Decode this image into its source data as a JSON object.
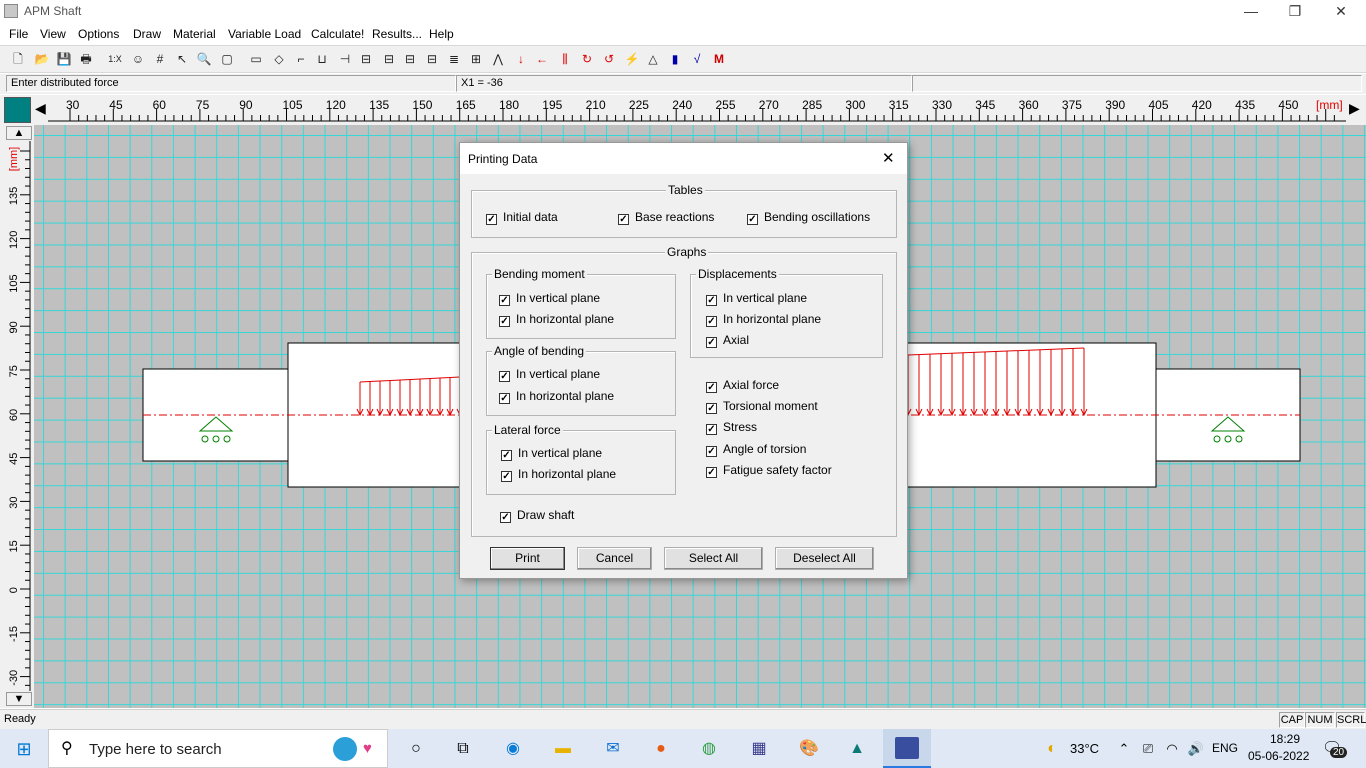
{
  "window": {
    "title": "APM Shaft",
    "minimize": "—",
    "restore": "❐",
    "close": "✕"
  },
  "menu": [
    "File",
    "View",
    "Options",
    "Draw",
    "Material",
    "Variable Load",
    "Calculate!",
    "Results...",
    "Help"
  ],
  "toolbar": {
    "zoom_label": "1:X"
  },
  "prompt": {
    "message": "Enter distributed force",
    "coords": "X1 = -36"
  },
  "hruler": {
    "labels": [
      "30",
      "45",
      "60",
      "75",
      "90",
      "105",
      "120",
      "135",
      "150",
      "165",
      "180",
      "195",
      "210",
      "225",
      "240",
      "255",
      "270",
      "285",
      "300",
      "315",
      "330",
      "345",
      "360",
      "375",
      "390",
      "405",
      "420",
      "435",
      "450"
    ],
    "unit": "[mm]"
  },
  "vruler": {
    "labels": [
      "135",
      "120",
      "105",
      "90",
      "75",
      "60",
      "45",
      "30",
      "15",
      "0",
      "-15",
      "-30"
    ],
    "unit": "[mm]"
  },
  "status": {
    "ready": "Ready",
    "cap": "CAP",
    "num": "NUM",
    "scrl": "SCRL"
  },
  "dialog": {
    "title": "Printing Data",
    "close": "✕",
    "tables": {
      "label": "Tables",
      "items": [
        "Initial data",
        "Base reactions",
        "Bending oscillations"
      ]
    },
    "graphs": {
      "label": "Graphs"
    },
    "bending_moment": {
      "label": "Bending moment",
      "items": [
        "In vertical plane",
        "In horizontal plane"
      ]
    },
    "angle_of_bending": {
      "label": "Angle of bending",
      "items": [
        "In vertical plane",
        "In horizontal plane"
      ]
    },
    "lateral_force": {
      "label": "Lateral force",
      "items": [
        "In vertical plane",
        "In horizontal plane"
      ]
    },
    "displacements": {
      "label": "Displacements",
      "items": [
        "In vertical plane",
        "In horizontal plane",
        "Axial"
      ]
    },
    "others": [
      "Axial force",
      "Torsional moment",
      "Stress",
      "Angle of torsion",
      "Fatigue safety factor"
    ],
    "draw_shaft": "Draw shaft",
    "buttons": {
      "print": "Print",
      "cancel": "Cancel",
      "select_all": "Select All",
      "deselect_all": "Deselect All"
    },
    "check_mark": "✓"
  },
  "taskbar": {
    "search": "Type here to search",
    "weather": "33°C",
    "lang": "ENG",
    "time": "18:29",
    "date": "05-06-2022",
    "notif": "20"
  },
  "colors": {
    "grid": "#37d7d7",
    "canvas": "#c0c0c0",
    "load": "#e00000",
    "support": "#008000",
    "axis": "#e00000"
  }
}
